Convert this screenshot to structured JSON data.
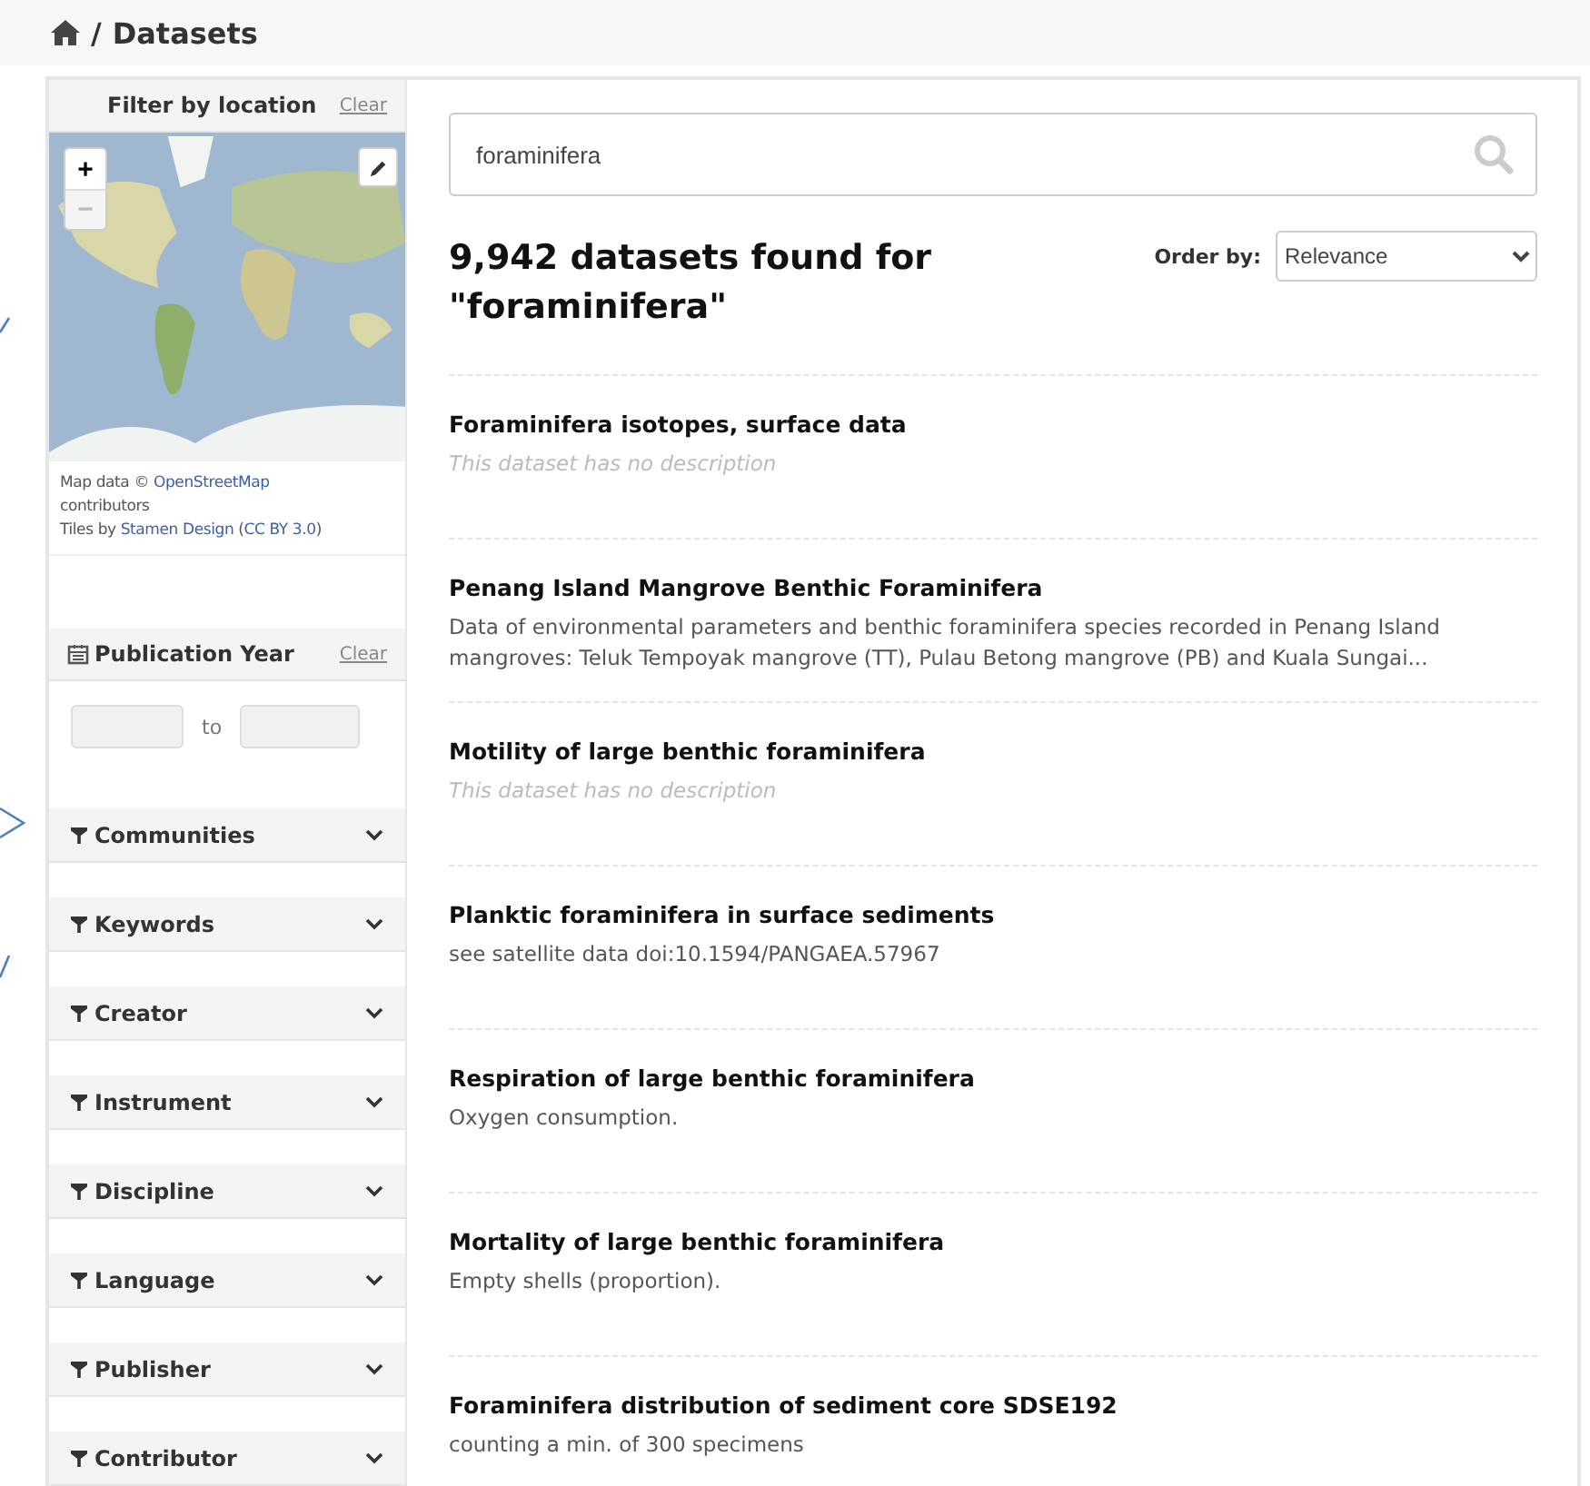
{
  "breadcrumb": {
    "separator": "/",
    "title": "Datasets"
  },
  "location_filter": {
    "title": "Filter by location",
    "clear": "Clear",
    "zoom_in": "+",
    "zoom_out": "−",
    "attribution": [
      {
        "kind": "text",
        "text": "Map data © "
      },
      {
        "kind": "link",
        "text": "OpenStreetMap"
      },
      {
        "kind": "text",
        "text": " contributors"
      },
      {
        "kind": "break"
      },
      {
        "kind": "text",
        "text": "Tiles by "
      },
      {
        "kind": "link",
        "text": "Stamen Design"
      },
      {
        "kind": "text",
        "text": " ("
      },
      {
        "kind": "link",
        "text": "CC BY 3.0"
      },
      {
        "kind": "text",
        "text": ")"
      }
    ]
  },
  "publication_year": {
    "title": "Publication Year",
    "clear": "Clear",
    "separator": "to"
  },
  "facets": [
    {
      "label": "Communities",
      "expanded": false
    },
    {
      "label": "Keywords",
      "expanded": false
    },
    {
      "label": "Creator",
      "expanded": false
    },
    {
      "label": "Instrument",
      "expanded": false
    },
    {
      "label": "Discipline",
      "expanded": false
    },
    {
      "label": "Language",
      "expanded": false
    },
    {
      "label": "Publisher",
      "expanded": false
    },
    {
      "label": "Contributor",
      "expanded": false
    }
  ],
  "search": {
    "value": "foraminifera"
  },
  "results_heading": "9,942 datasets found for \"foraminifera\"",
  "order_by": {
    "label": "Order by:",
    "value": "Relevance"
  },
  "results": [
    {
      "title": "Foraminifera isotopes, surface data",
      "kind": "empty",
      "description": "This dataset has no description"
    },
    {
      "title": "Penang Island Mangrove Benthic Foraminifera",
      "kind": "text",
      "description": "Data of environmental parameters and benthic foraminifera species recorded in Penang Island mangroves: Teluk Tempoyak mangrove (TT), Pulau Betong mangrove (PB) and Kuala Sungai..."
    },
    {
      "title": "Motility of large benthic foraminifera",
      "kind": "empty",
      "description": "This dataset has no description"
    },
    {
      "title": "Planktic foraminifera in surface sediments",
      "kind": "text",
      "description": "see satellite data doi:10.1594/PANGAEA.57967"
    },
    {
      "title": "Respiration of large benthic foraminifera",
      "kind": "text",
      "description": "Oxygen consumption."
    },
    {
      "title": "Mortality of large benthic foraminifera",
      "kind": "text",
      "description": "Empty shells (proportion)."
    },
    {
      "title": "Foraminifera distribution of sediment core SDSE192",
      "kind": "text",
      "description": "counting a min. of 300 specimens"
    }
  ]
}
